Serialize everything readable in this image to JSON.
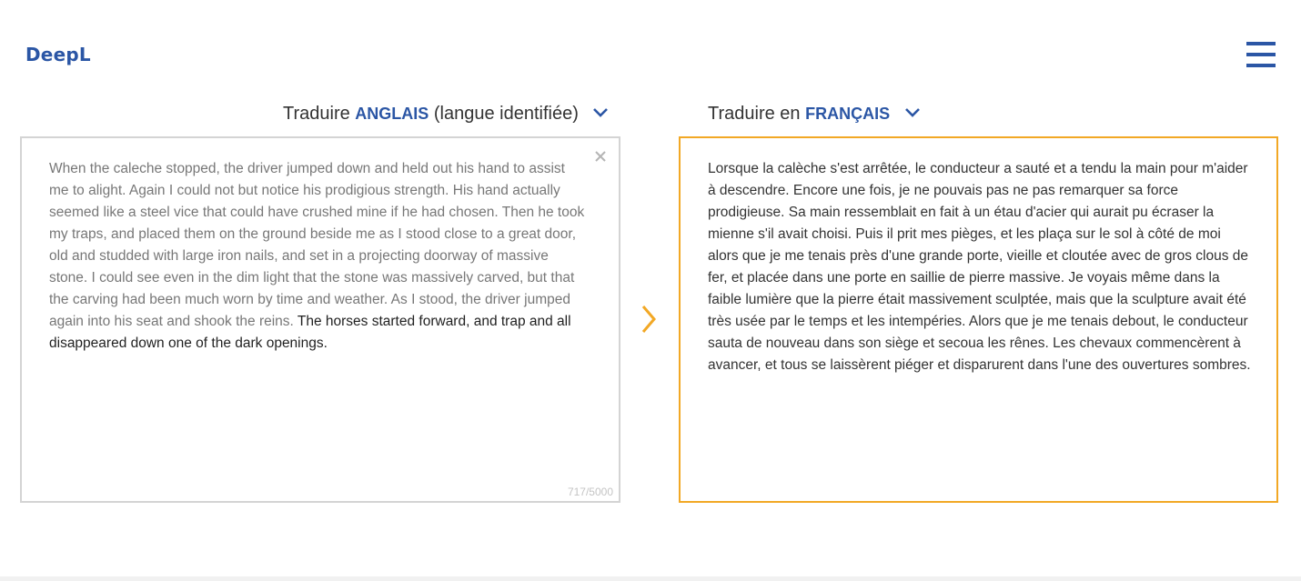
{
  "app": {
    "logo": "DeepL"
  },
  "source": {
    "prefix": "Traduire ",
    "language": "ANGLAIS",
    "suffix": " (langue identifiée)",
    "text_muted": "When the caleche stopped, the driver jumped down and held out his hand to assist me to alight. Again I could not but notice his prodigious strength. His hand actually seemed like a steel vice that could have crushed mine if he had chosen. Then he took my traps, and placed them on the ground beside me as I stood close to a great door, old and studded with large iron nails, and set in a projecting doorway of massive stone. I could see even in the dim light that the stone was massively carved, but that the carving had been much worn by time and weather. As I stood, the driver jumped again into his seat and shook the reins.",
    "text_strong": " The horses started forward, and trap and all disappeared down one of the dark openings.",
    "char_count": "717/5000"
  },
  "target": {
    "prefix": "Traduire en ",
    "language": "FRANÇAIS",
    "text": "Lorsque la calèche s'est arrêtée, le conducteur a sauté et a tendu la main pour m'aider à descendre. Encore une fois, je ne pouvais pas ne pas remarquer sa force prodigieuse. Sa main ressemblait en fait à un étau d'acier qui aurait pu écraser la mienne s'il avait choisi. Puis il prit mes pièges, et les plaça sur le sol à côté de moi alors que je me tenais près d'une grande porte, vieille et cloutée avec de gros clous de fer, et placée dans une porte en saillie de pierre massive. Je voyais même dans la faible lumière que la pierre était massivement sculptée, mais que la sculpture avait été très usée par le temps et les intempéries. Alors que je me tenais debout, le conducteur sauta de nouveau dans son siège et secoua les rênes. Les chevaux commencèrent à avancer, et tous se laissèrent piéger et disparurent dans l'une des ouvertures sombres."
  },
  "icons": {
    "menu": "hamburger-icon",
    "chevron": "chevron-down-icon",
    "clear": "close-icon",
    "arrow": "chevron-right-icon"
  },
  "colors": {
    "brand": "#2b56a5",
    "accent": "#f2a825",
    "border": "#d4d4d4"
  }
}
